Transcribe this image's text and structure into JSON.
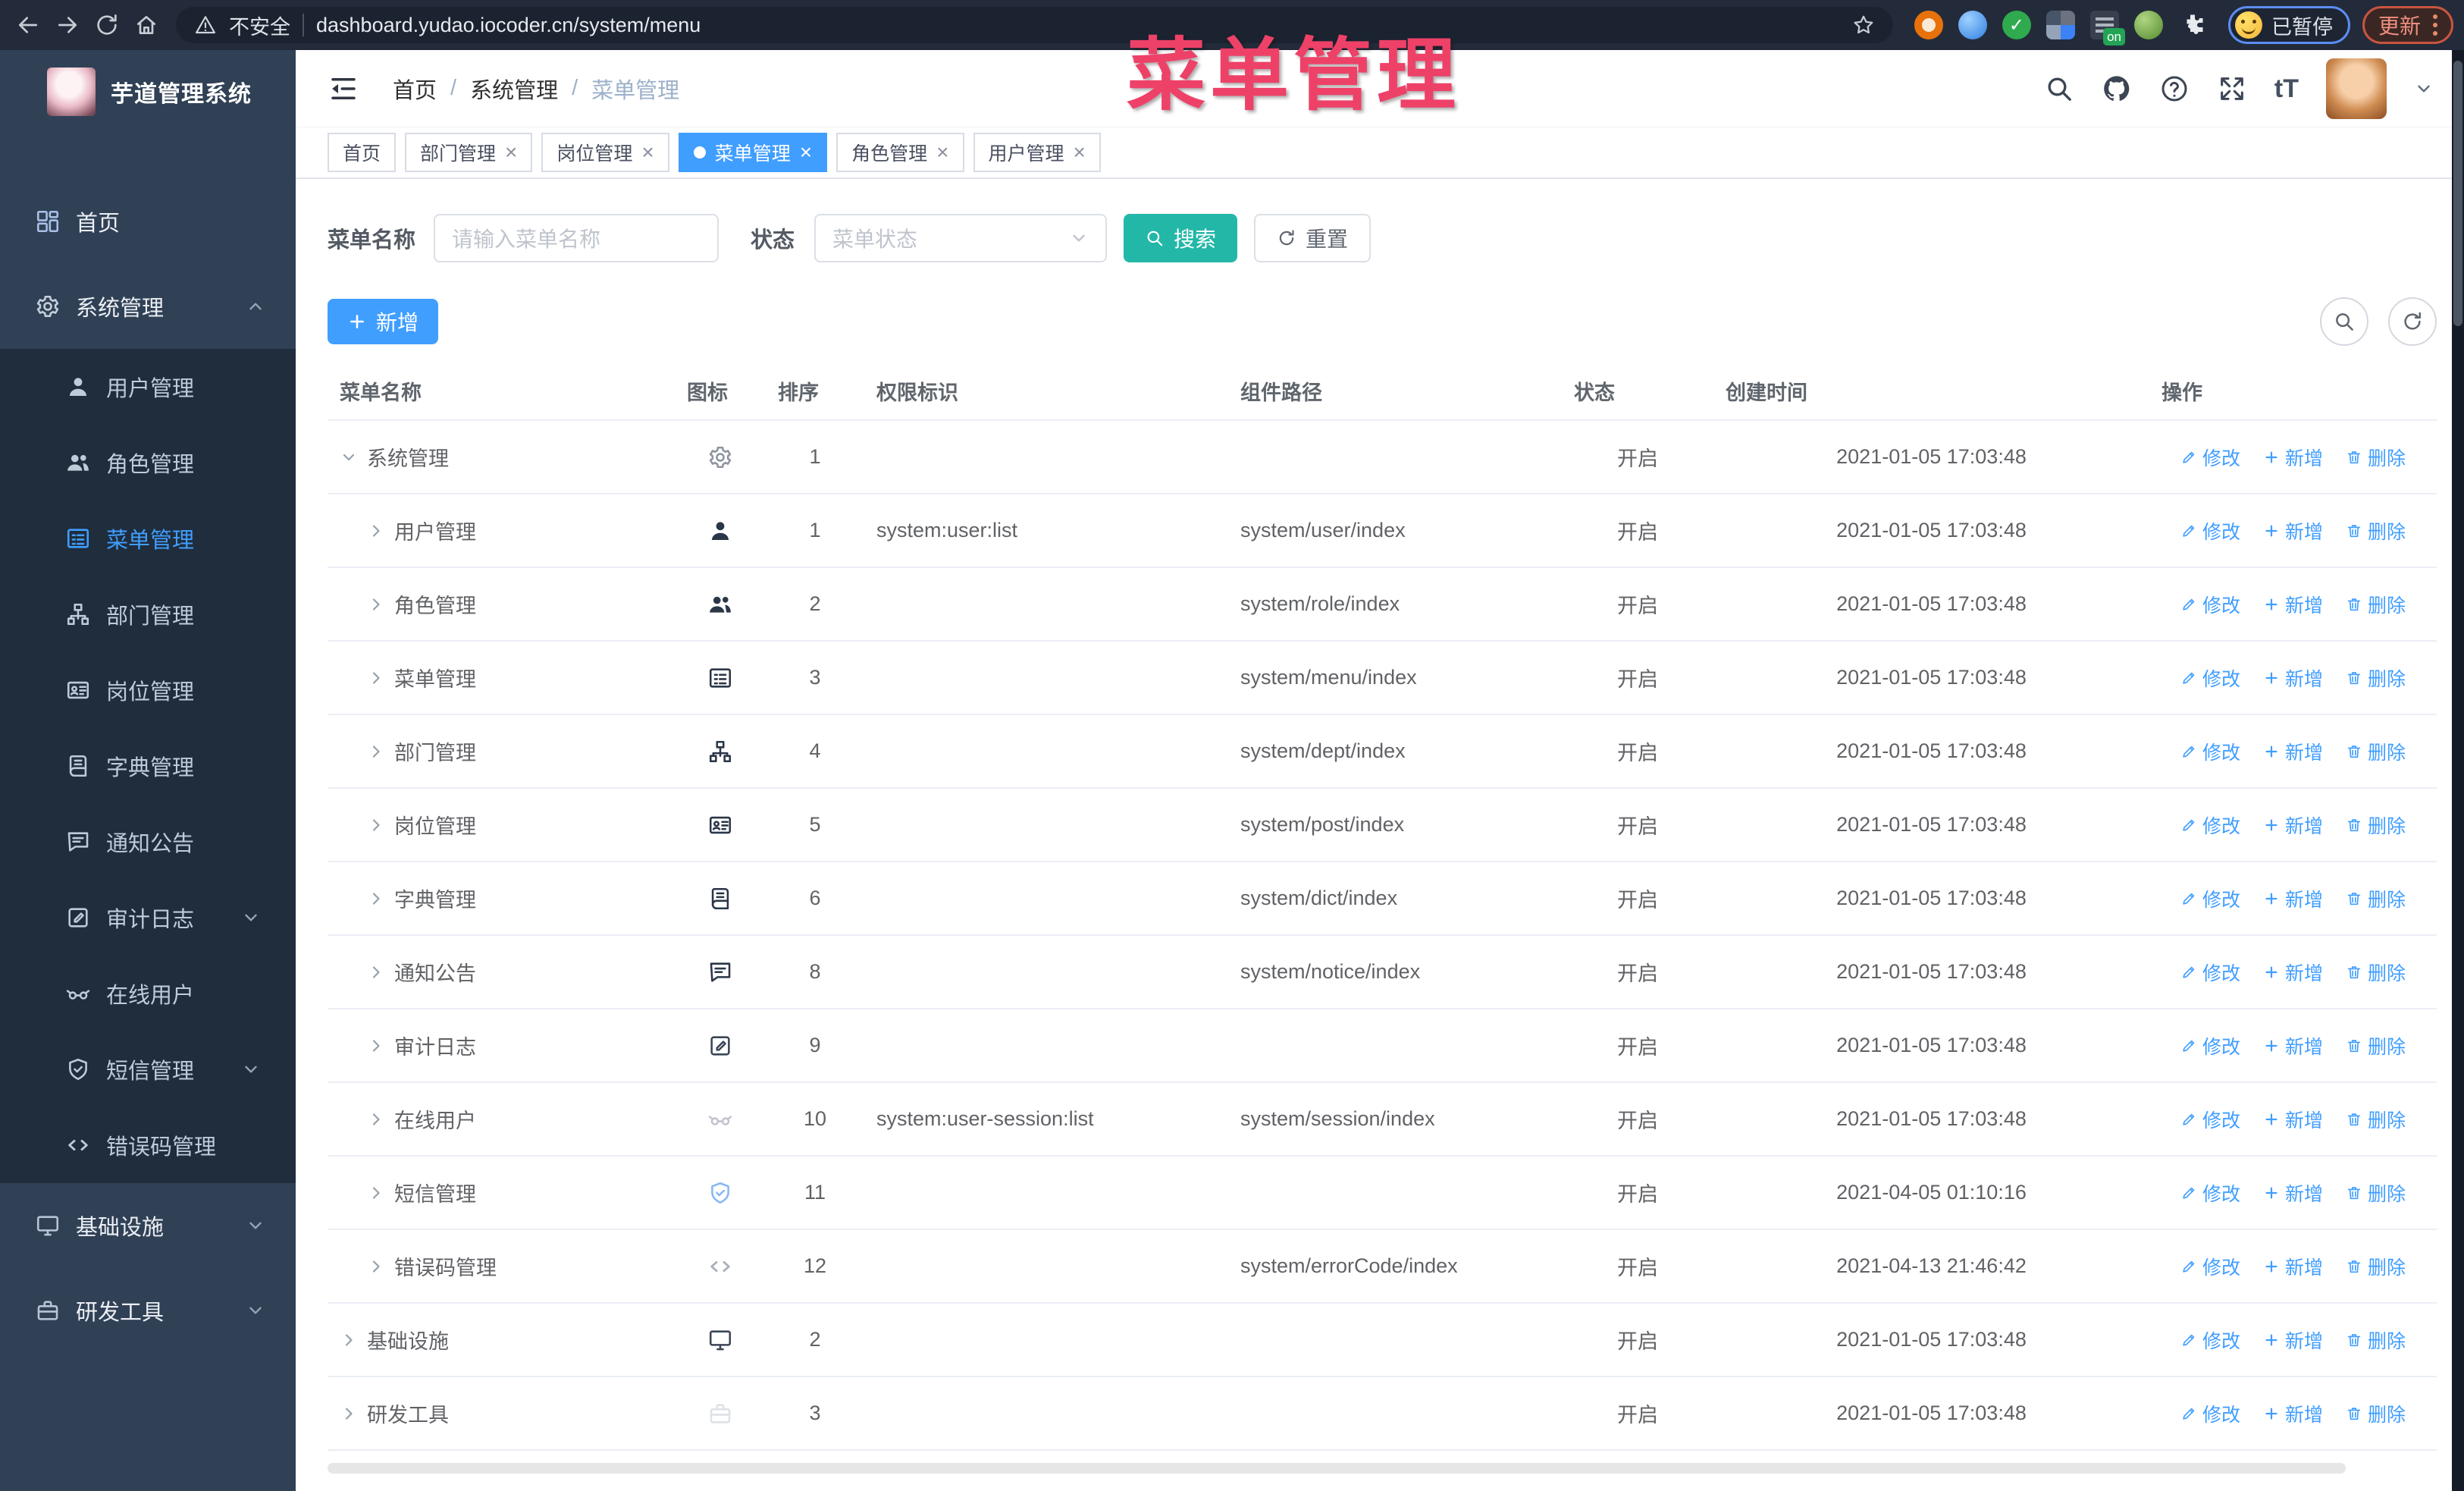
{
  "browser": {
    "security_label": "不安全",
    "url": "dashboard.yudao.iocoder.cn/system/menu",
    "profile_label": "已暂停",
    "update_label": "更新",
    "extensions": [
      {
        "icon": "ext-orange",
        "color": "#e8710a"
      },
      {
        "icon": "ext-gem",
        "color": "#2f7de1"
      },
      {
        "icon": "ext-check",
        "color": "#2faa4f",
        "glyph": "✓"
      },
      {
        "icon": "ext-grid",
        "color": "#3b82f6"
      },
      {
        "icon": "ext-onoff",
        "color": "#39404d",
        "badge": "on"
      },
      {
        "icon": "ext-monkey",
        "color": "#558b2f"
      },
      {
        "icon": "ext-puzzle",
        "color": "#e8eaed"
      }
    ]
  },
  "annotation": {
    "title": "菜单管理",
    "color": "#ee4168"
  },
  "sidebar": {
    "logo_title": "芋道管理系统",
    "items": [
      {
        "label": "首页",
        "icon": "dashboard-icon",
        "icon_color": "#a9c0e8"
      },
      {
        "label": "系统管理",
        "icon": "gear-icon",
        "icon_color": "#c6d0dd",
        "chevron": "up",
        "expanded": true,
        "children": [
          {
            "label": "用户管理",
            "icon": "user-icon"
          },
          {
            "label": "角色管理",
            "icon": "users-icon"
          },
          {
            "label": "菜单管理",
            "icon": "menu-icon",
            "active": true
          },
          {
            "label": "部门管理",
            "icon": "tree-icon"
          },
          {
            "label": "岗位管理",
            "icon": "badge-icon"
          },
          {
            "label": "字典管理",
            "icon": "dict-icon"
          },
          {
            "label": "通知公告",
            "icon": "message-icon"
          },
          {
            "label": "审计日志",
            "icon": "log-icon",
            "chevron": "down"
          },
          {
            "label": "在线用户",
            "icon": "online-icon"
          },
          {
            "label": "短信管理",
            "icon": "shield-icon",
            "chevron": "down"
          },
          {
            "label": "错误码管理",
            "icon": "code-icon"
          }
        ]
      },
      {
        "label": "基础设施",
        "icon": "monitor-icon",
        "icon_color": "#b8c4d4",
        "chevron": "down"
      },
      {
        "label": "研发工具",
        "icon": "toolbox-icon",
        "icon_color": "#b8c4d4",
        "chevron": "down"
      }
    ]
  },
  "header": {
    "breadcrumb": [
      "首页",
      "系统管理",
      "菜单管理"
    ],
    "separator": "/"
  },
  "tabs": [
    {
      "label": "首页",
      "closable": false,
      "active": false
    },
    {
      "label": "部门管理",
      "closable": true,
      "active": false
    },
    {
      "label": "岗位管理",
      "closable": true,
      "active": false
    },
    {
      "label": "菜单管理",
      "closable": true,
      "active": true
    },
    {
      "label": "角色管理",
      "closable": true,
      "active": false
    },
    {
      "label": "用户管理",
      "closable": true,
      "active": false
    }
  ],
  "filters": {
    "name_label": "菜单名称",
    "name_placeholder": "请输入菜单名称",
    "status_label": "状态",
    "status_placeholder": "菜单状态",
    "search_label": "搜索",
    "reset_label": "重置"
  },
  "toolbar": {
    "add_label": "新增"
  },
  "table": {
    "columns": [
      "菜单名称",
      "图标",
      "排序",
      "权限标识",
      "组件路径",
      "状态",
      "创建时间",
      "操作"
    ],
    "actions": {
      "edit": "修改",
      "add": "新增",
      "remove": "删除"
    },
    "rows": [
      {
        "name": "系统管理",
        "level": 0,
        "expanded": true,
        "icon": "gear-icon",
        "icon_color": "#8d949d",
        "sort": "1",
        "perm": "",
        "path": "",
        "status": "开启",
        "created": "2021-01-05 17:03:48"
      },
      {
        "name": "用户管理",
        "level": 1,
        "expanded": false,
        "icon": "user-icon",
        "icon_color": "#2b3648",
        "sort": "1",
        "perm": "system:user:list",
        "path": "system/user/index",
        "status": "开启",
        "created": "2021-01-05 17:03:48"
      },
      {
        "name": "角色管理",
        "level": 1,
        "expanded": false,
        "icon": "users-icon",
        "icon_color": "#2b3648",
        "sort": "2",
        "perm": "",
        "path": "system/role/index",
        "status": "开启",
        "created": "2021-01-05 17:03:48"
      },
      {
        "name": "菜单管理",
        "level": 1,
        "expanded": false,
        "icon": "menu-icon",
        "icon_color": "#2b3648",
        "sort": "3",
        "perm": "",
        "path": "system/menu/index",
        "status": "开启",
        "created": "2021-01-05 17:03:48"
      },
      {
        "name": "部门管理",
        "level": 1,
        "expanded": false,
        "icon": "tree-icon",
        "icon_color": "#2b3648",
        "sort": "4",
        "perm": "",
        "path": "system/dept/index",
        "status": "开启",
        "created": "2021-01-05 17:03:48"
      },
      {
        "name": "岗位管理",
        "level": 1,
        "expanded": false,
        "icon": "badge-icon",
        "icon_color": "#2b3648",
        "sort": "5",
        "perm": "",
        "path": "system/post/index",
        "status": "开启",
        "created": "2021-01-05 17:03:48"
      },
      {
        "name": "字典管理",
        "level": 1,
        "expanded": false,
        "icon": "dict-icon",
        "icon_color": "#2b3648",
        "sort": "6",
        "perm": "",
        "path": "system/dict/index",
        "status": "开启",
        "created": "2021-01-05 17:03:48"
      },
      {
        "name": "通知公告",
        "level": 1,
        "expanded": false,
        "icon": "message-icon",
        "icon_color": "#2b3648",
        "sort": "8",
        "perm": "",
        "path": "system/notice/index",
        "status": "开启",
        "created": "2021-01-05 17:03:48"
      },
      {
        "name": "审计日志",
        "level": 1,
        "expanded": false,
        "icon": "log-icon",
        "icon_color": "#3a4656",
        "sort": "9",
        "perm": "",
        "path": "",
        "status": "开启",
        "created": "2021-01-05 17:03:48"
      },
      {
        "name": "在线用户",
        "level": 1,
        "expanded": false,
        "icon": "online-icon",
        "icon_color": "#c0c4cc",
        "sort": "10",
        "perm": "system:user-session:list",
        "path": "system/session/index",
        "status": "开启",
        "created": "2021-01-05 17:03:48"
      },
      {
        "name": "短信管理",
        "level": 1,
        "expanded": false,
        "icon": "shield-icon",
        "icon_color": "#85b9f3",
        "sort": "11",
        "perm": "",
        "path": "",
        "status": "开启",
        "created": "2021-04-05 01:10:16"
      },
      {
        "name": "错误码管理",
        "level": 1,
        "expanded": false,
        "icon": "code-icon",
        "icon_color": "#aab0ba",
        "sort": "12",
        "perm": "",
        "path": "system/errorCode/index",
        "status": "开启",
        "created": "2021-04-13 21:46:42"
      },
      {
        "name": "基础设施",
        "level": 0,
        "expanded": false,
        "icon": "monitor-icon",
        "icon_color": "#3a4656",
        "sort": "2",
        "perm": "",
        "path": "",
        "status": "开启",
        "created": "2021-01-05 17:03:48"
      },
      {
        "name": "研发工具",
        "level": 0,
        "expanded": false,
        "icon": "toolbox-icon",
        "icon_color": "#dde1e8",
        "sort": "3",
        "perm": "",
        "path": "",
        "status": "开启",
        "created": "2021-01-05 17:03:48"
      }
    ]
  },
  "colors": {
    "accent": "#409eff",
    "search_button": "#23b7a8",
    "sidebar_bg": "#304156",
    "submenu_bg": "#1f2d3d",
    "active_tab": "#409eff"
  }
}
